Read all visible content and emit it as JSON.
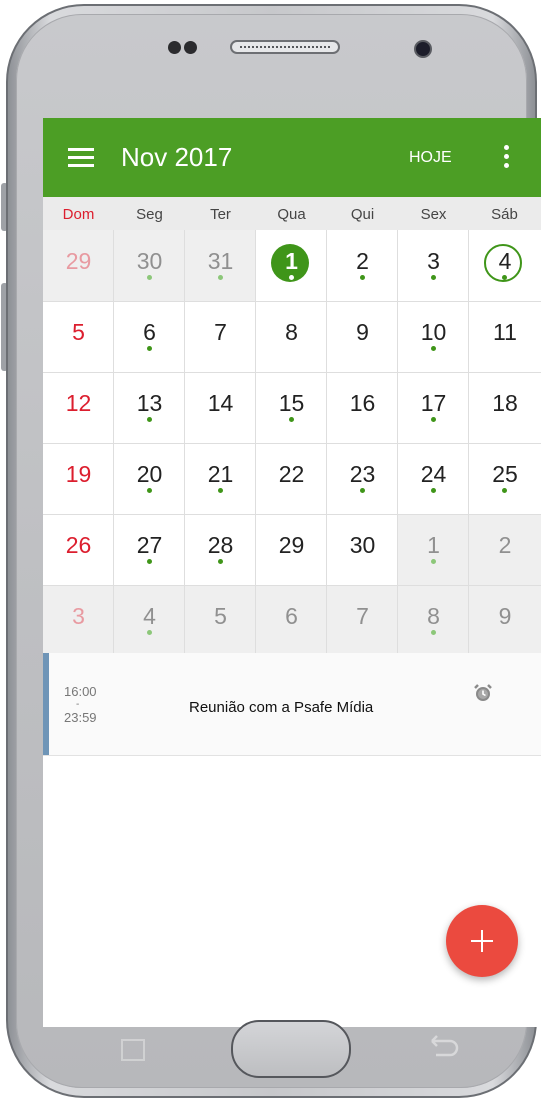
{
  "app": {
    "title": "Nov 2017",
    "today_label": "HOJE",
    "accent_color": "#4c9e25",
    "sunday_color": "#dc1e2e"
  },
  "weekdays": [
    "Dom",
    "Seg",
    "Ter",
    "Qua",
    "Qui",
    "Sex",
    "Sáb"
  ],
  "calendar": {
    "weeks": [
      [
        {
          "day": "29",
          "muted": true
        },
        {
          "day": "30",
          "muted": true,
          "event": true
        },
        {
          "day": "31",
          "muted": true,
          "event": true
        },
        {
          "day": "1",
          "today": true,
          "event": true
        },
        {
          "day": "2",
          "event": true
        },
        {
          "day": "3",
          "event": true
        },
        {
          "day": "4",
          "selected": true,
          "event": true
        }
      ],
      [
        {
          "day": "5"
        },
        {
          "day": "6",
          "event": true
        },
        {
          "day": "7"
        },
        {
          "day": "8"
        },
        {
          "day": "9"
        },
        {
          "day": "10",
          "event": true
        },
        {
          "day": "11"
        }
      ],
      [
        {
          "day": "12"
        },
        {
          "day": "13",
          "event": true
        },
        {
          "day": "14"
        },
        {
          "day": "15",
          "event": true
        },
        {
          "day": "16"
        },
        {
          "day": "17",
          "event": true
        },
        {
          "day": "18"
        }
      ],
      [
        {
          "day": "19"
        },
        {
          "day": "20",
          "event": true
        },
        {
          "day": "21",
          "event": true
        },
        {
          "day": "22"
        },
        {
          "day": "23",
          "event": true
        },
        {
          "day": "24",
          "event": true
        },
        {
          "day": "25",
          "event": true
        }
      ],
      [
        {
          "day": "26"
        },
        {
          "day": "27",
          "event": true
        },
        {
          "day": "28",
          "event": true
        },
        {
          "day": "29"
        },
        {
          "day": "30"
        },
        {
          "day": "1",
          "muted": true,
          "event": true
        },
        {
          "day": "2",
          "muted": true
        }
      ],
      [
        {
          "day": "3",
          "muted": true
        },
        {
          "day": "4",
          "muted": true,
          "event": true
        },
        {
          "day": "5",
          "muted": true
        },
        {
          "day": "6",
          "muted": true
        },
        {
          "day": "7",
          "muted": true
        },
        {
          "day": "8",
          "muted": true,
          "event": true
        },
        {
          "day": "9",
          "muted": true
        }
      ]
    ]
  },
  "event": {
    "start": "16:00",
    "separator": "-",
    "end": "23:59",
    "title": "Reunião com a Psafe Mídia",
    "icon": "alarm-icon",
    "color": "#6f95b7"
  },
  "fab": {
    "icon": "plus-icon",
    "color": "#eb4a3f"
  }
}
